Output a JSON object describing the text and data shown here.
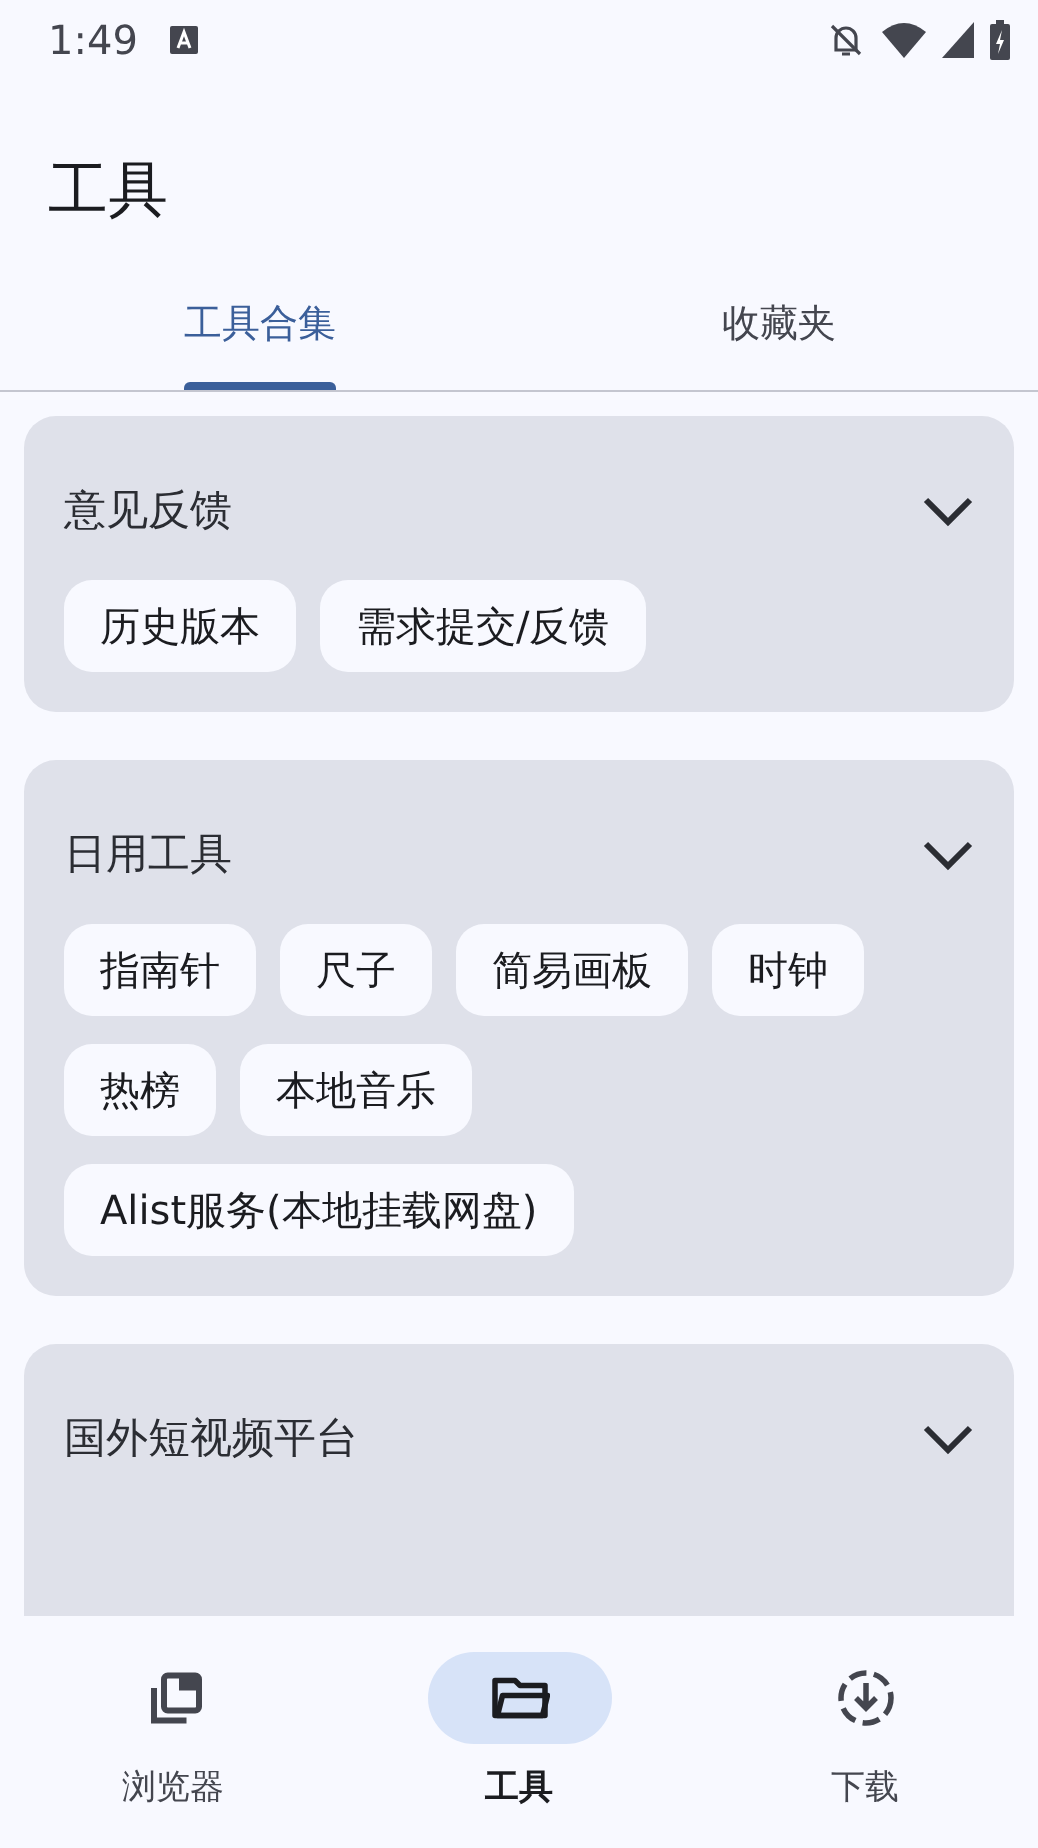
{
  "status_bar": {
    "time": "1:49"
  },
  "title": "工具",
  "tabs": [
    {
      "label": "工具合集",
      "selected": true
    },
    {
      "label": "收藏夹",
      "selected": false
    }
  ],
  "sections": [
    {
      "title": "意见反馈",
      "expanded": true,
      "items": [
        "历史版本",
        "需求提交/反馈"
      ]
    },
    {
      "title": "日用工具",
      "expanded": true,
      "items": [
        "指南针",
        "尺子",
        "简易画板",
        "时钟",
        "热榜",
        "本地音乐",
        "Alist服务(本地挂载网盘)"
      ]
    },
    {
      "title": "国外短视频平台",
      "expanded": true
    }
  ],
  "bottom_nav": [
    {
      "label": "浏览器",
      "selected": false
    },
    {
      "label": "工具",
      "selected": true
    },
    {
      "label": "下载",
      "selected": false
    }
  ]
}
